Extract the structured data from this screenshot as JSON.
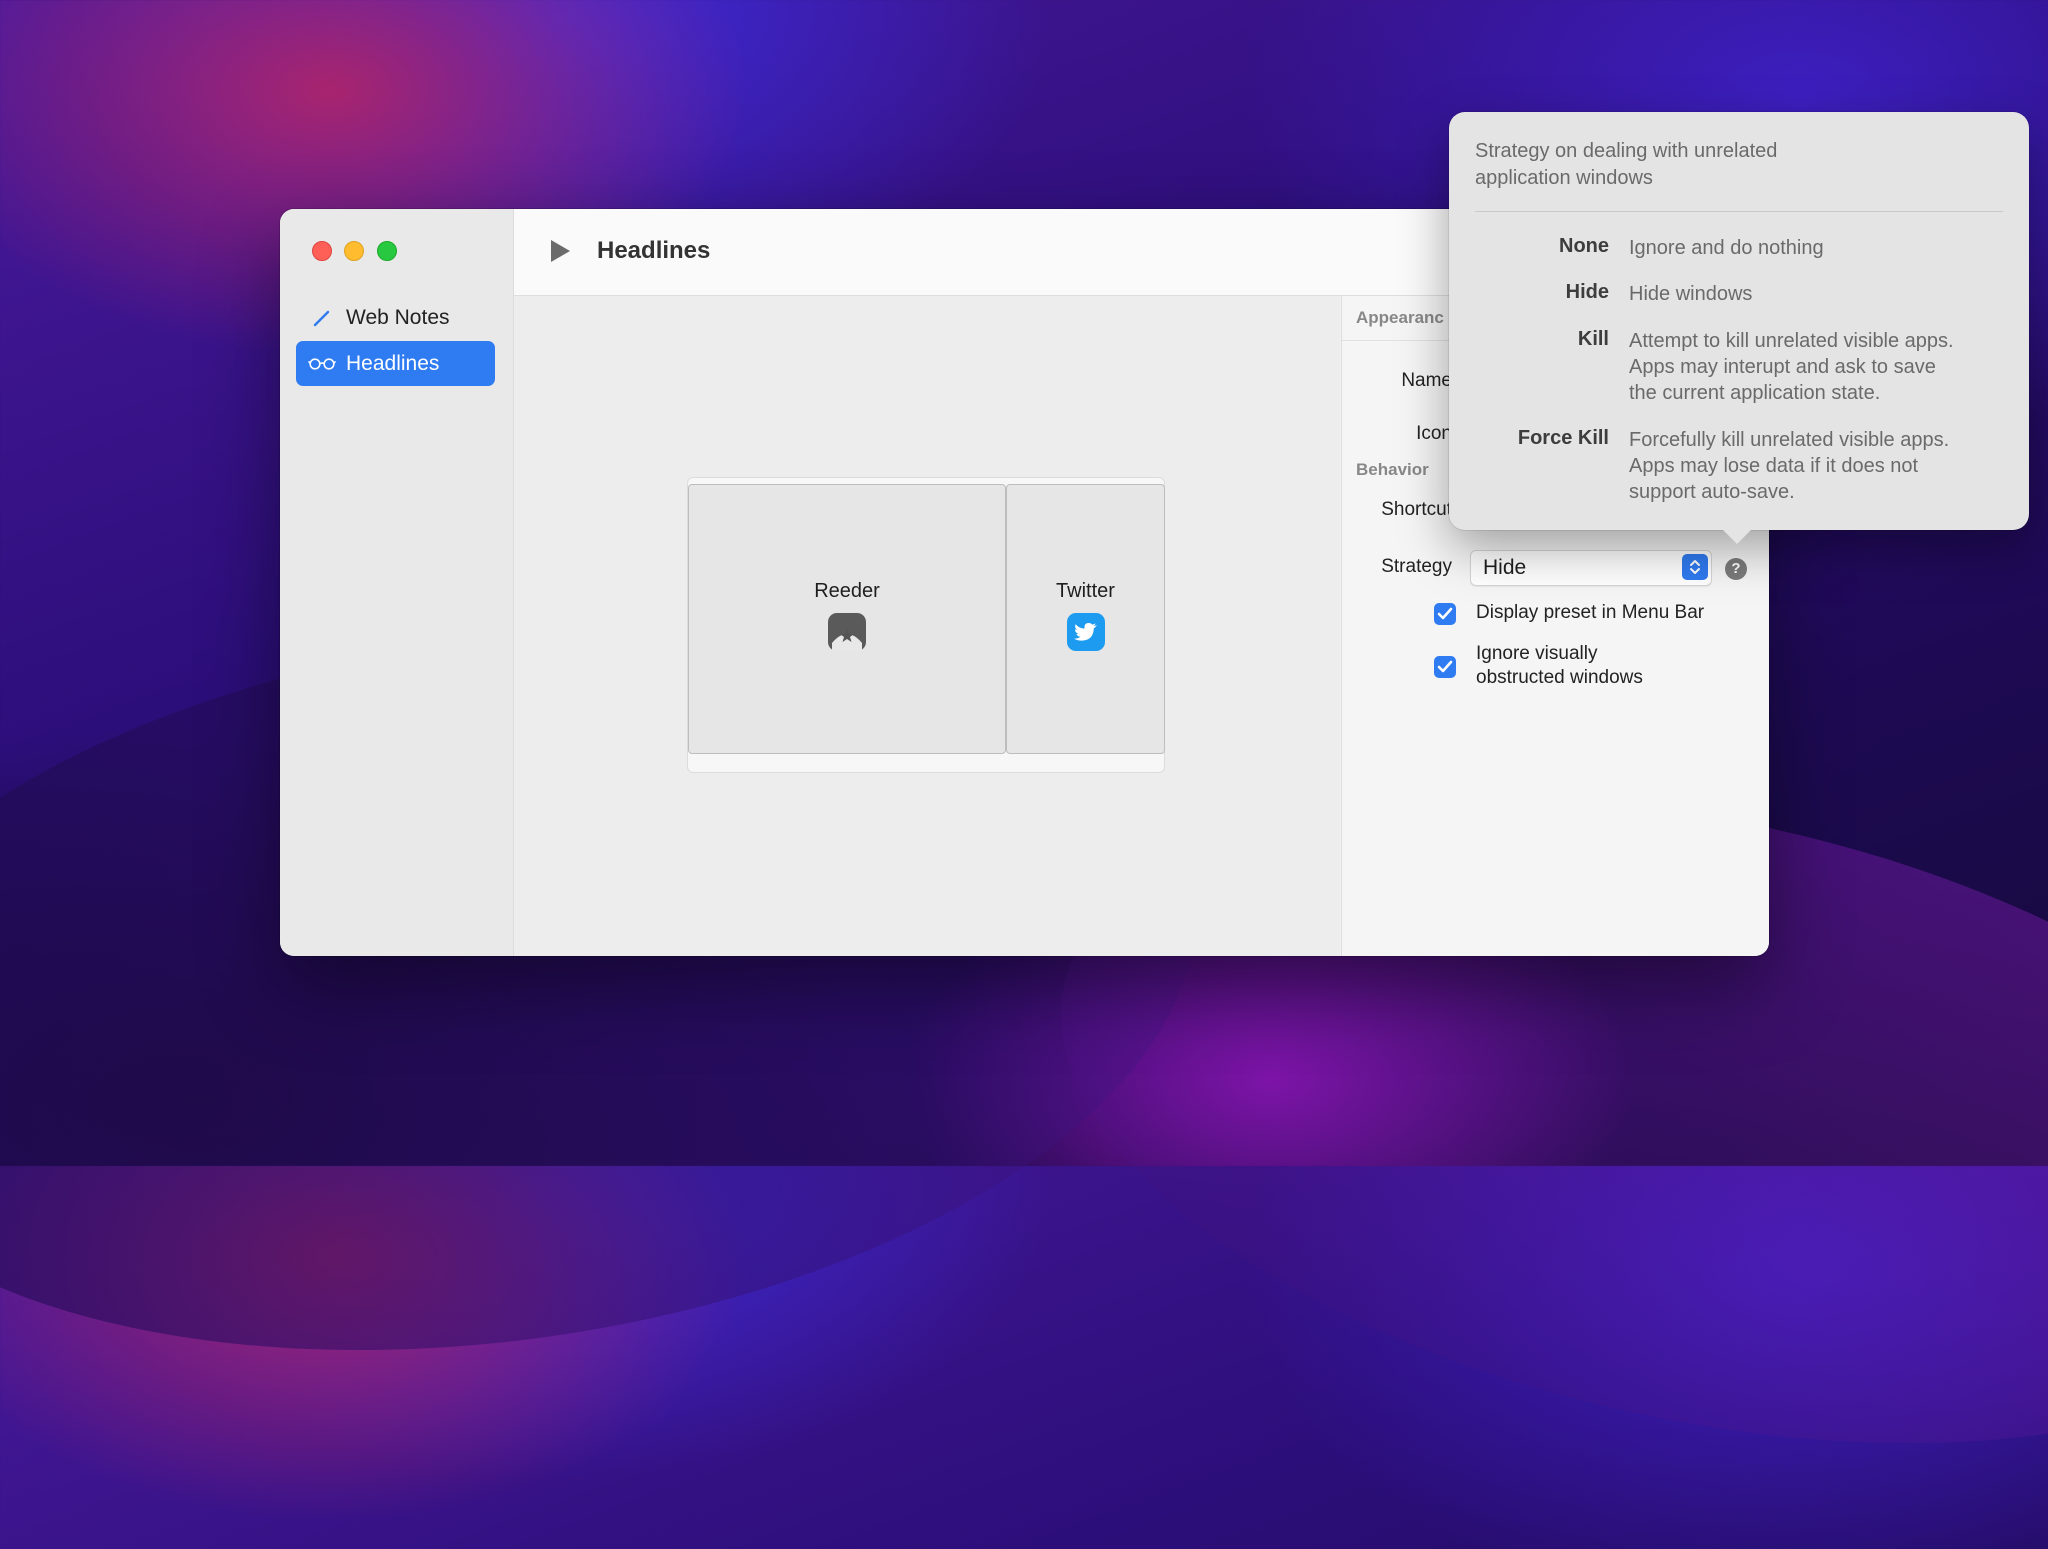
{
  "sidebar": {
    "items": [
      {
        "label": "Web Notes",
        "icon": "pencil-icon"
      },
      {
        "label": "Headlines",
        "icon": "glasses-icon",
        "selected": true
      }
    ]
  },
  "toolbar": {
    "title": "Headlines",
    "run_icon": "play-icon"
  },
  "preview": {
    "tiles": [
      {
        "label": "Reeder",
        "icon": "reeder-app-icon"
      },
      {
        "label": "Twitter",
        "icon": "twitter-app-icon"
      }
    ]
  },
  "inspector": {
    "appearance_header": "Appearanc",
    "name_label": "Name",
    "icon_label": "Icon",
    "behavior_header": "Behavior",
    "shortcut_label": "Shortcut",
    "strategy_label": "Strategy",
    "strategy_value": "Hide",
    "help_glyph": "?",
    "display_in_menu_bar": {
      "label": "Display preset in Menu Bar",
      "checked": true
    },
    "ignore_obstructed": {
      "label_line1": "Ignore visually",
      "label_line2": "obstructed windows",
      "checked": true
    }
  },
  "popover": {
    "heading_line1": "Strategy on dealing with unrelated",
    "heading_line2": "application windows",
    "options": [
      {
        "name": "None",
        "lines": [
          "Ignore and do nothing"
        ]
      },
      {
        "name": "Hide",
        "lines": [
          "Hide windows"
        ]
      },
      {
        "name": "Kill",
        "lines": [
          "Attempt to kill unrelated visible apps.",
          "Apps may interupt and ask to save",
          "the current application state."
        ]
      },
      {
        "name": "Force Kill",
        "lines": [
          "Forcefully kill unrelated visible apps.",
          "Apps may lose data if it does not",
          "support auto-save."
        ]
      }
    ]
  },
  "colors": {
    "accent": "#2f7bf1",
    "close": "#fe5f57",
    "minimize": "#febc2e",
    "zoom": "#28c840",
    "twitter": "#1d9bf0"
  }
}
